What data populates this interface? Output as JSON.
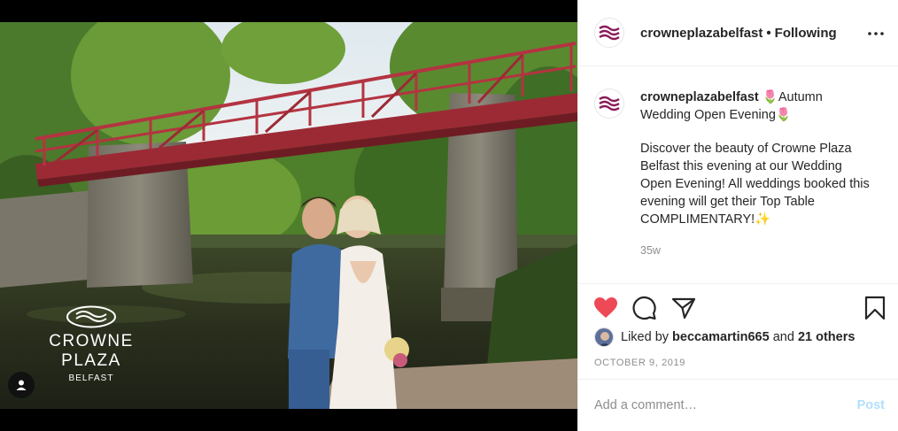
{
  "post": {
    "account": "crowneplazabelfast",
    "separator": "•",
    "follow_status": "Following",
    "more_icon": "more-horizontal-icon",
    "caption": {
      "line1": "🌷Autumn Wedding Open Evening🌷",
      "line2": "Discover the beauty of Crowne Plaza Belfast this evening at our Wedding Open Evening! All weddings booked this evening will get their Top Table COMPLIMENTARY!✨",
      "time_ago": "35w"
    },
    "likes": {
      "prefix": "Liked by",
      "liker": "beccamartin665",
      "connector": "and",
      "others": "21 others"
    },
    "date": "OCTOBER 9, 2019",
    "comment_placeholder": "Add a comment…",
    "post_button": "Post"
  },
  "photo": {
    "brand_name": "CROWNE PLAZA",
    "brand_city": "BELFAST"
  },
  "colors": {
    "heart": "#ed4956",
    "bridge": "#9c2a35",
    "brand_purple": "#8a1b58",
    "post_button_disabled": "#b2dffc"
  }
}
